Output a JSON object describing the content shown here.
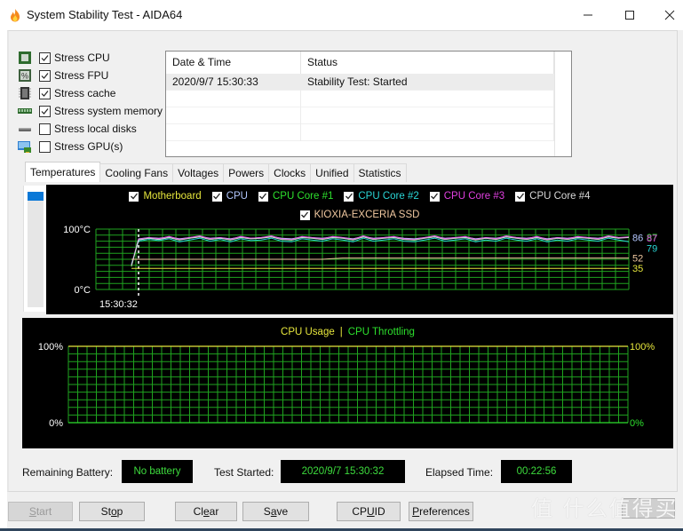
{
  "window": {
    "title": "System Stability Test - AIDA64",
    "controls": {
      "minimize": "—",
      "maximize": "☐",
      "close": "✕"
    }
  },
  "stress_options": [
    {
      "label": "Stress CPU",
      "checked": true,
      "icon": "cpu-chip-icon"
    },
    {
      "label": "Stress FPU",
      "checked": true,
      "icon": "fpu-percent-icon"
    },
    {
      "label": "Stress cache",
      "checked": true,
      "icon": "cache-chip-icon"
    },
    {
      "label": "Stress system memory",
      "checked": true,
      "icon": "memory-module-icon"
    },
    {
      "label": "Stress local disks",
      "checked": false,
      "icon": "disk-drive-icon"
    },
    {
      "label": "Stress GPU(s)",
      "checked": false,
      "icon": "gpu-monitor-icon"
    }
  ],
  "log": {
    "columns": [
      "Date & Time",
      "Status"
    ],
    "rows": [
      [
        "2020/9/7 15:30:33",
        "Stability Test: Started"
      ]
    ]
  },
  "tabs": [
    {
      "label": "Temperatures",
      "active": true
    },
    {
      "label": "Cooling Fans",
      "active": false
    },
    {
      "label": "Voltages",
      "active": false
    },
    {
      "label": "Powers",
      "active": false
    },
    {
      "label": "Clocks",
      "active": false
    },
    {
      "label": "Unified",
      "active": false
    },
    {
      "label": "Statistics",
      "active": false
    }
  ],
  "chart_data": [
    {
      "type": "line",
      "title": "Temperatures",
      "ylabel": "°C",
      "y_top_label": "100°C",
      "y_bottom_label": "0°C",
      "ylim": [
        0,
        100
      ],
      "x_start_label": "15:30:32",
      "grid": true,
      "legend_placement": "top-center",
      "series": [
        {
          "name": "Motherboard",
          "color": "#e6e63c",
          "checked": true,
          "current": 35,
          "values": [
            35,
            35,
            35,
            35,
            35,
            35,
            35,
            35,
            35,
            35,
            35,
            35,
            35,
            35,
            35,
            35,
            35,
            35,
            35,
            35,
            35,
            35,
            35,
            35,
            35,
            35,
            35,
            35,
            35,
            35,
            35,
            35,
            35,
            35,
            35,
            35,
            35,
            35,
            35,
            35,
            35,
            35,
            35,
            35,
            35,
            35,
            35,
            35,
            35,
            35
          ]
        },
        {
          "name": "CPU",
          "color": "#b4c8ff",
          "checked": true,
          "current": 86,
          "values": [
            40,
            84,
            86,
            85,
            87,
            84,
            86,
            88,
            85,
            86,
            84,
            87,
            85,
            86,
            88,
            85,
            84,
            87,
            86,
            85,
            87,
            86,
            84,
            88,
            85,
            86,
            87,
            85,
            84,
            86,
            88,
            85,
            86,
            87,
            84,
            86,
            85,
            88,
            86,
            85,
            87,
            84,
            86,
            85,
            87,
            86,
            85,
            88,
            86,
            86
          ]
        },
        {
          "name": "CPU Core #1",
          "color": "#2de02d",
          "checked": true,
          "current": 87,
          "values": [
            38,
            82,
            85,
            83,
            86,
            82,
            85,
            87,
            83,
            85,
            82,
            86,
            84,
            85,
            87,
            83,
            82,
            86,
            85,
            83,
            86,
            85,
            82,
            87,
            83,
            85,
            86,
            83,
            82,
            85,
            87,
            83,
            85,
            86,
            82,
            85,
            83,
            87,
            85,
            83,
            86,
            82,
            85,
            83,
            86,
            85,
            83,
            87,
            85,
            87
          ]
        },
        {
          "name": "CPU Core #2",
          "color": "#2ad6d6",
          "checked": true,
          "current": 79,
          "values": [
            42,
            80,
            83,
            81,
            84,
            79,
            82,
            85,
            80,
            83,
            79,
            84,
            81,
            82,
            85,
            80,
            79,
            84,
            82,
            80,
            84,
            82,
            79,
            85,
            80,
            82,
            84,
            80,
            79,
            82,
            85,
            80,
            82,
            84,
            79,
            82,
            80,
            85,
            82,
            80,
            84,
            79,
            82,
            80,
            84,
            82,
            80,
            85,
            82,
            79
          ]
        },
        {
          "name": "CPU Core #3",
          "color": "#e040e0",
          "checked": true,
          "current": 87,
          "values": [
            40,
            83,
            86,
            84,
            88,
            83,
            86,
            89,
            84,
            86,
            83,
            88,
            85,
            86,
            89,
            84,
            83,
            88,
            86,
            84,
            88,
            86,
            83,
            89,
            84,
            86,
            88,
            84,
            83,
            86,
            89,
            84,
            86,
            88,
            83,
            86,
            84,
            89,
            86,
            84,
            88,
            83,
            86,
            84,
            88,
            86,
            84,
            89,
            86,
            87
          ]
        },
        {
          "name": "CPU Core #4",
          "color": "#d8d8d8",
          "checked": true,
          "current": 86,
          "values": [
            39,
            82,
            85,
            83,
            86,
            82,
            85,
            87,
            83,
            85,
            82,
            86,
            84,
            85,
            87,
            83,
            82,
            86,
            85,
            83,
            86,
            85,
            82,
            87,
            83,
            85,
            86,
            83,
            82,
            85,
            87,
            83,
            85,
            86,
            82,
            85,
            83,
            87,
            85,
            83,
            86,
            82,
            85,
            83,
            86,
            85,
            83,
            87,
            85,
            86
          ]
        },
        {
          "name": "KIOXIA-EXCERIA SSD",
          "color": "#f0c8a0",
          "checked": true,
          "current": 52,
          "values": [
            50,
            50,
            50,
            50,
            50,
            50,
            50,
            50,
            50,
            50,
            50,
            50,
            50,
            50,
            50,
            50,
            50,
            50,
            50,
            50,
            51,
            52,
            52,
            52,
            52,
            52,
            52,
            52,
            52,
            52,
            52,
            52,
            52,
            52,
            52,
            52,
            52,
            52,
            52,
            52,
            52,
            52,
            52,
            52,
            52,
            52,
            52,
            52,
            52,
            52
          ]
        }
      ],
      "value_labels": [
        "86",
        "87",
        "79",
        "52",
        "35"
      ]
    },
    {
      "type": "line",
      "title": "CPU Usage | CPU Throttling",
      "legend": [
        {
          "name": "CPU Usage",
          "color": "#e6e63c"
        },
        {
          "name": "CPU Throttling",
          "color": "#2de02d"
        }
      ],
      "separator": "|",
      "y_top_label_left": "100%",
      "y_bottom_label_left": "0%",
      "y_top_label_right": "100%",
      "y_bottom_label_right": "0%",
      "ylim": [
        0,
        100
      ],
      "grid": true,
      "series": [
        {
          "name": "CPU Usage",
          "color": "#e6e63c",
          "current": 100
        },
        {
          "name": "CPU Throttling",
          "color": "#2de02d",
          "current": 0
        }
      ]
    }
  ],
  "status": {
    "battery_label": "Remaining Battery:",
    "battery_value": "No battery",
    "started_label": "Test Started:",
    "started_value": "2020/9/7 15:30:32",
    "elapsed_label": "Elapsed Time:",
    "elapsed_value": "00:22:56"
  },
  "buttons": {
    "start": {
      "pre": "",
      "ul": "S",
      "post": "tart",
      "enabled": false
    },
    "stop": {
      "pre": "St",
      "ul": "o",
      "post": "p",
      "enabled": true
    },
    "clear": {
      "pre": "Cl",
      "ul": "e",
      "post": "ar",
      "enabled": true
    },
    "save": {
      "pre": "S",
      "ul": "a",
      "post": "ve",
      "enabled": true
    },
    "cpuid": {
      "pre": "CP",
      "ul": "U",
      "post": "ID",
      "enabled": true
    },
    "preferences": {
      "pre": "",
      "ul": "P",
      "post": "references",
      "enabled": true
    }
  },
  "watermark": "值 什么值得买",
  "colors": {
    "graph_bg": "#000000",
    "grid": "#1fa31f",
    "status_text": "#3ddc3d",
    "scroll_thumb": "#0a78d7"
  }
}
